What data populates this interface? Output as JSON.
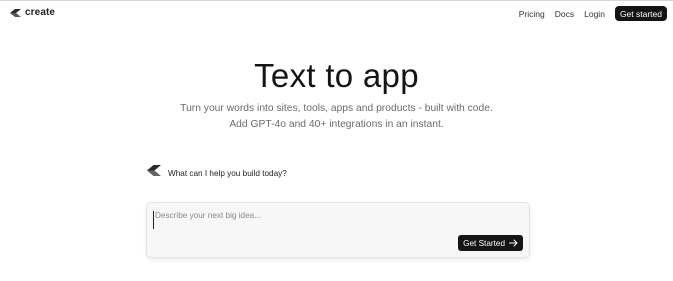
{
  "brand": {
    "name": "create",
    "logo_icon": "create-logo-icon"
  },
  "nav": {
    "links": [
      {
        "label": "Pricing"
      },
      {
        "label": "Docs"
      },
      {
        "label": "Login"
      }
    ],
    "cta_label": "Get started"
  },
  "hero": {
    "title": "Text to app",
    "subtitle_line1": "Turn your words into sites, tools, apps and products - built with code.",
    "subtitle_line2": "Add GPT-4o and 40+ integrations in an instant."
  },
  "prompt": {
    "icon": "create-logo-icon",
    "question": "What can I help you build today?"
  },
  "input": {
    "placeholder": "Describe your next big idea...",
    "value": "",
    "submit_label": "Get Started",
    "submit_icon": "arrow-right-icon"
  },
  "colors": {
    "primary_dark": "#141414",
    "subtitle_gray": "#6b6b6b",
    "card_bg": "#f7f7f7"
  }
}
